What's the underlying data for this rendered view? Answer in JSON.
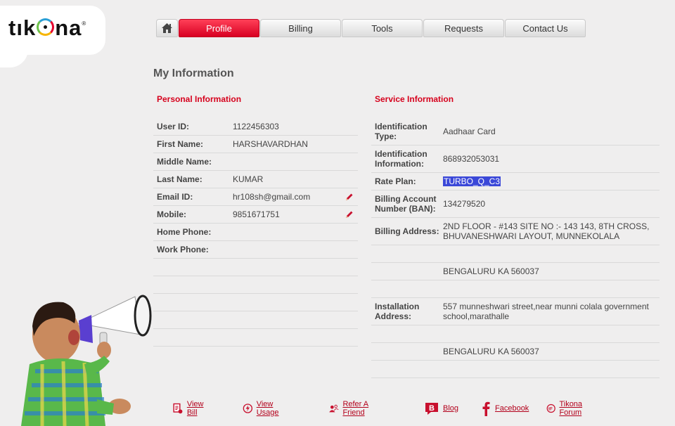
{
  "brand": {
    "name": "tikona"
  },
  "nav": {
    "tabs": [
      {
        "label": "Profile"
      },
      {
        "label": "Billing"
      },
      {
        "label": "Tools"
      },
      {
        "label": "Requests"
      },
      {
        "label": "Contact Us"
      }
    ],
    "active": "Profile",
    "accent": "#e4001f"
  },
  "page": {
    "title": "My Information"
  },
  "personal": {
    "title": "Personal Information",
    "rows": [
      {
        "label": "User ID:",
        "value": "1122456303"
      },
      {
        "label": "First Name:",
        "value": "HARSHAVARDHAN"
      },
      {
        "label": "Middle Name:",
        "value": ""
      },
      {
        "label": "Last Name:",
        "value": "KUMAR"
      },
      {
        "label": "Email ID:",
        "value": "hr108sh@gmail.com"
      },
      {
        "label": "Mobile:",
        "value": "9851671751"
      },
      {
        "label": "Home Phone:",
        "value": ""
      },
      {
        "label": "Work Phone:",
        "value": ""
      }
    ]
  },
  "service": {
    "title": "Service Information",
    "rows": [
      {
        "label": "Identification Type:",
        "value": "Aadhaar Card"
      },
      {
        "label": "Identification Information:",
        "value": "868932053031"
      },
      {
        "label": "Rate Plan:",
        "value": "TURBO_Q_C3"
      },
      {
        "label": "Billing Account Number (BAN):",
        "value": "134279520"
      },
      {
        "label": "Billing Address:",
        "value": "2ND FLOOR - #143 SITE NO :- 143 143, 8TH CROSS, BHUVANESHWARI LAYOUT, MUNNEKOLALA"
      },
      {
        "label": "",
        "value": ""
      },
      {
        "label": "",
        "value": "BENGALURU KA 560037"
      },
      {
        "label": "",
        "value": ""
      },
      {
        "label": "Installation Address:",
        "value": "557 munneshwari street,near munni colala government school,marathalle"
      },
      {
        "label": "",
        "value": ""
      },
      {
        "label": "",
        "value": "BENGALURU KA 560037"
      },
      {
        "label": "",
        "value": ""
      }
    ]
  },
  "footer": {
    "links": [
      {
        "label": "View Bill",
        "icon": "bill-icon"
      },
      {
        "label": "View Usage",
        "icon": "usage-icon"
      },
      {
        "label": "Refer A Friend",
        "icon": "refer-friend-icon"
      },
      {
        "label": "Blog",
        "icon": "blog-icon"
      },
      {
        "label": "Facebook",
        "icon": "facebook-icon"
      },
      {
        "label": "Tikona Forum",
        "icon": "forum-icon"
      }
    ]
  }
}
